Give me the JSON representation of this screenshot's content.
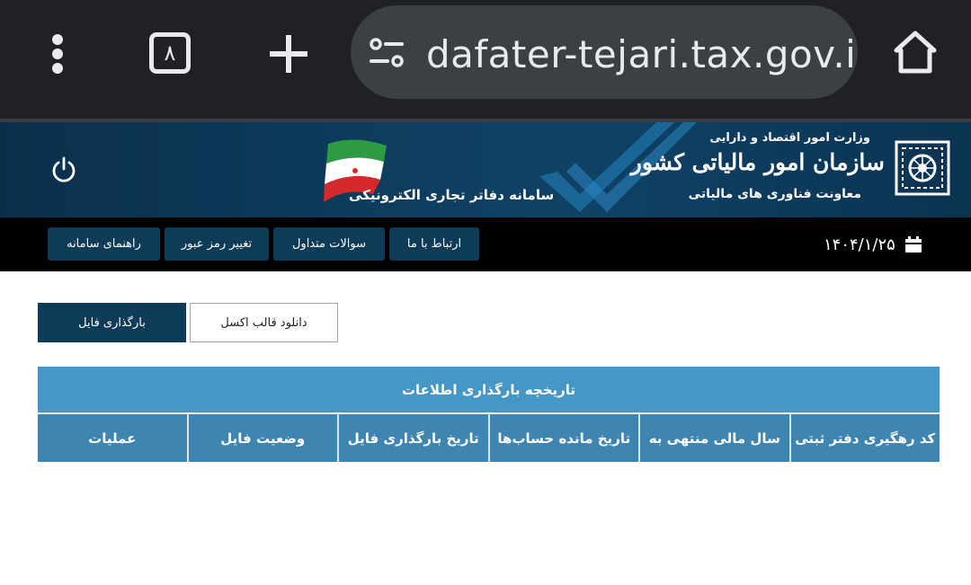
{
  "browser": {
    "tab_count": "٨",
    "url": "dafater-tejari.tax.gov.ir/t"
  },
  "banner": {
    "system_name": "سامانه دفاتر تجاری الکترونیکی",
    "ministry": "وزارت امور اقتصاد و دارایی",
    "org_name": "سازمان امور مالیاتی کشور",
    "deputy": "معاونت فناوری های مالیاتی"
  },
  "nav": {
    "date": "۱۴۰۴/۱/۲۵",
    "items": [
      {
        "label": "ارتباط با ما"
      },
      {
        "label": "سوالات متداول"
      },
      {
        "label": "تغییر رمز عبور"
      },
      {
        "label": "راهنمای سامانه"
      }
    ]
  },
  "actions": {
    "upload_label": "بارگذاری فایل",
    "download_excel_label": "دانلود قالب اکسل"
  },
  "history_table": {
    "title": "تاریخچه بارگذاری اطلاعات",
    "columns": [
      "کد رهگیری دفتر ثبتی",
      "سال مالی منتهی به",
      "تاریخ مانده حساب‌ها",
      "تاریخ بارگذاری فایل",
      "وضعیت فایل",
      "عملیات"
    ],
    "rows": []
  },
  "colors": {
    "brand_dark": "#0e3b57",
    "table_title": "#4597c5",
    "table_header": "#3e85b2"
  }
}
